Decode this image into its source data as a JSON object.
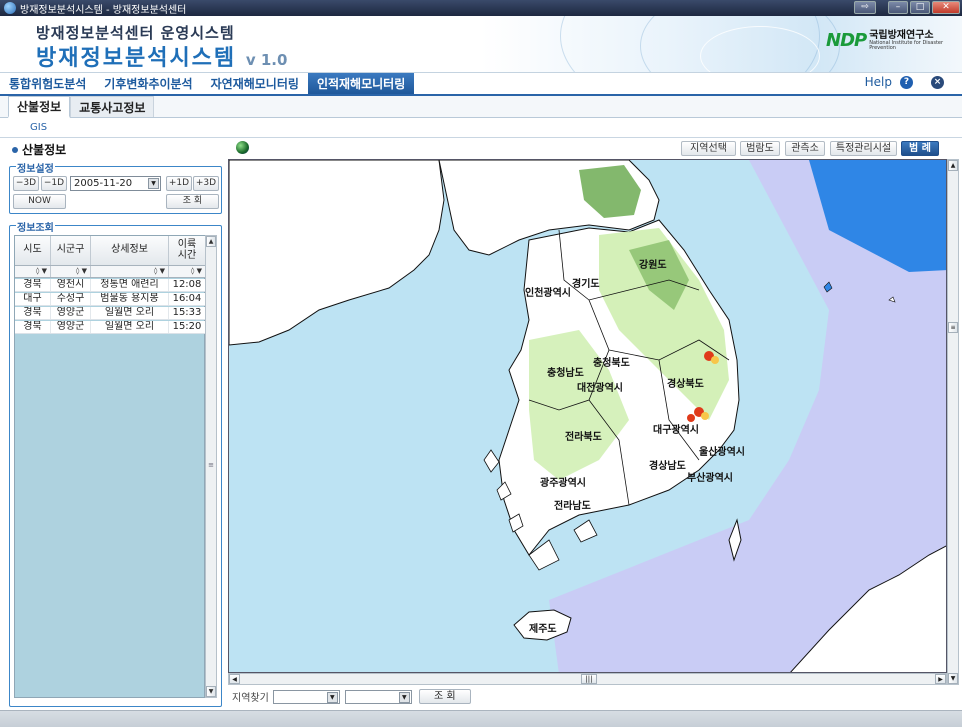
{
  "window": {
    "title": "방재정보분석시스템 - 방재정보분석센터",
    "minimize_icon": "minimize-icon",
    "maximize_icon": "maximize-icon",
    "close_icon": "close-icon"
  },
  "header": {
    "subtitle": "방재정보분석센터 운영시스템",
    "title": "방재정보분석시스템",
    "version": "v 1.0",
    "logo_mark": "NDP",
    "logo_org_ko": "국립방재연구소",
    "logo_org_en": "National Institute for Disaster Prevention"
  },
  "nav": {
    "items": [
      {
        "label": "통합위험도분석",
        "active": false
      },
      {
        "label": "기후변화추이분석",
        "active": false
      },
      {
        "label": "자연재해모니터링",
        "active": false
      },
      {
        "label": "인적재해모니터링",
        "active": true
      }
    ],
    "help_label": "Help",
    "help_icon": "?",
    "close_icon": "×"
  },
  "subtabs": {
    "items": [
      {
        "label": "산불정보",
        "active": true
      },
      {
        "label": "교통사고정보",
        "active": false
      }
    ],
    "gis_label": "GIS"
  },
  "panel": {
    "title": "산불정보",
    "settings": {
      "legend": "정보설정",
      "btn_minus3": "−3D",
      "btn_minus1": "−1D",
      "date_value": "2005-11-20",
      "btn_plus1": "+1D",
      "btn_plus3": "+3D",
      "btn_now": "NOW",
      "btn_search": "조 회"
    },
    "query": {
      "legend": "정보조회",
      "columns": [
        "시도",
        "시군구",
        "상세정보",
        "이륙시간"
      ],
      "filter_symbol": "◊ ▼",
      "rows": [
        [
          "경북",
          "영천시",
          "청통면 애련리",
          "12:08"
        ],
        [
          "대구",
          "수성구",
          "범물동 용지봉",
          "16:04"
        ],
        [
          "경북",
          "영양군",
          "일월면 오리",
          "15:33"
        ],
        [
          "경북",
          "영양군",
          "일월면 오리",
          "15:20"
        ]
      ]
    }
  },
  "map": {
    "toolbar": [
      "지역선택",
      "범람도",
      "관측소",
      "특정관리시설",
      "범 례"
    ],
    "active_tool": "범 례",
    "labels": [
      "강원도",
      "경기도",
      "인천광역시",
      "충청북도",
      "충청남도",
      "대전광역시",
      "경상북도",
      "대구광역시",
      "전라북도",
      "울산광역시",
      "경상남도",
      "부산광역시",
      "광주광역시",
      "전라남도",
      "제주도"
    ],
    "colors": {
      "sea_light": "#bde3f3",
      "sea_mid": "#c9ccf5",
      "sea_deep": "#2f86e6",
      "land": "#ffffff",
      "forest_light": "#cfeeb0",
      "forest_dark": "#5aa03c"
    }
  },
  "finder": {
    "label": "지역찾기",
    "select1": "",
    "select2": "",
    "button": "조 회"
  }
}
